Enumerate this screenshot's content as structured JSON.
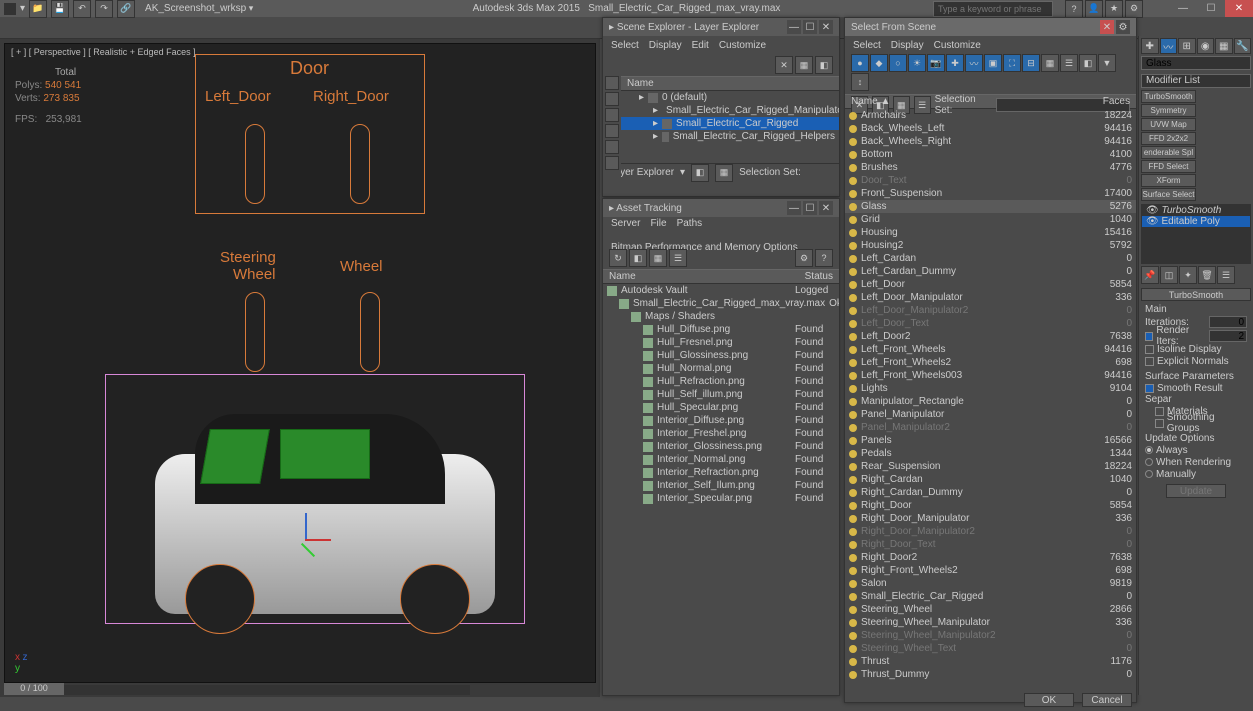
{
  "title": {
    "app": "Autodesk 3ds Max  2015",
    "file": "Small_Electric_Car_Rigged_max_vray.max"
  },
  "workspace": {
    "label": "AK_Screenshot_wrksp"
  },
  "search": {
    "placeholder": "Type a keyword or phrase"
  },
  "viewport": {
    "label": "[ + ] [ Perspective ] [ Realistic + Edged Faces ]",
    "stats_hdr": "Total",
    "polys_lbl": "Polys:",
    "polys": "540 541",
    "verts_lbl": "Verts:",
    "verts": "273 835",
    "fps_lbl": "FPS:",
    "fps": "253,981",
    "helpers": {
      "door": "Door",
      "left_door": "Left_Door",
      "right_door": "Right_Door",
      "steering": "Steering",
      "wheel1": "Wheel",
      "wheel2": "Wheel"
    },
    "timeline": "0 / 100"
  },
  "scene_explorer": {
    "title": "Scene Explorer - Layer Explorer",
    "menus": [
      "Select",
      "Display",
      "Edit",
      "Customize"
    ],
    "cols": {
      "name": "Name"
    },
    "tree": [
      {
        "label": "0 (default)",
        "indent": 1
      },
      {
        "label": "Small_Electric_Car_Rigged_Manipulator",
        "indent": 2
      },
      {
        "label": "Small_Electric_Car_Rigged",
        "indent": 2,
        "sel": true
      },
      {
        "label": "Small_Electric_Car_Rigged_Helpers",
        "indent": 2
      }
    ],
    "footer_mode": "Layer Explorer",
    "footer_sel": "Selection Set:"
  },
  "asset_tracking": {
    "title": "Asset Tracking",
    "menus": [
      "Server",
      "File",
      "Paths",
      "Bitmap Performance and Memory Options"
    ],
    "cols": {
      "name": "Name",
      "status": "Status"
    },
    "rows": [
      {
        "name": "Autodesk Vault",
        "status": "Logged",
        "indent": 0
      },
      {
        "name": "Small_Electric_Car_Rigged_max_vray.max",
        "status": "Ok",
        "indent": 1
      },
      {
        "name": "Maps / Shaders",
        "status": "",
        "indent": 2
      },
      {
        "name": "Hull_Diffuse.png",
        "status": "Found",
        "indent": 3
      },
      {
        "name": "Hull_Fresnel.png",
        "status": "Found",
        "indent": 3
      },
      {
        "name": "Hull_Glossiness.png",
        "status": "Found",
        "indent": 3
      },
      {
        "name": "Hull_Normal.png",
        "status": "Found",
        "indent": 3
      },
      {
        "name": "Hull_Refraction.png",
        "status": "Found",
        "indent": 3
      },
      {
        "name": "Hull_Self_illum.png",
        "status": "Found",
        "indent": 3
      },
      {
        "name": "Hull_Specular.png",
        "status": "Found",
        "indent": 3
      },
      {
        "name": "Interior_Diffuse.png",
        "status": "Found",
        "indent": 3
      },
      {
        "name": "Interior_Freshel.png",
        "status": "Found",
        "indent": 3
      },
      {
        "name": "Interior_Glossiness.png",
        "status": "Found",
        "indent": 3
      },
      {
        "name": "Interior_Normal.png",
        "status": "Found",
        "indent": 3
      },
      {
        "name": "Interior_Refraction.png",
        "status": "Found",
        "indent": 3
      },
      {
        "name": "Interior_Self_Ilum.png",
        "status": "Found",
        "indent": 3
      },
      {
        "name": "Interior_Specular.png",
        "status": "Found",
        "indent": 3
      }
    ]
  },
  "select_from_scene": {
    "title": "Select From Scene",
    "menus": [
      "Select",
      "Display",
      "Customize"
    ],
    "selset": "Selection Set:",
    "cols": {
      "name": "Name",
      "faces": "Faces"
    },
    "rows": [
      {
        "name": "Armchairs",
        "faces": "18224"
      },
      {
        "name": "Back_Wheels_Left",
        "faces": "94416"
      },
      {
        "name": "Back_Wheels_Right",
        "faces": "94416"
      },
      {
        "name": "Bottom",
        "faces": "4100"
      },
      {
        "name": "Brushes",
        "faces": "4776"
      },
      {
        "name": "Door_Text",
        "faces": "0",
        "frozen": true
      },
      {
        "name": "Front_Suspension",
        "faces": "17400"
      },
      {
        "name": "Glass",
        "faces": "5276",
        "sel": true
      },
      {
        "name": "Grid",
        "faces": "1040"
      },
      {
        "name": "Housing",
        "faces": "15416"
      },
      {
        "name": "Housing2",
        "faces": "5792"
      },
      {
        "name": "Left_Cardan",
        "faces": "0"
      },
      {
        "name": "Left_Cardan_Dummy",
        "faces": "0"
      },
      {
        "name": "Left_Door",
        "faces": "5854"
      },
      {
        "name": "Left_Door_Manipulator",
        "faces": "336"
      },
      {
        "name": "Left_Door_Manipulator2",
        "faces": "0",
        "frozen": true
      },
      {
        "name": "Left_Door_Text",
        "faces": "0",
        "frozen": true
      },
      {
        "name": "Left_Door2",
        "faces": "7638"
      },
      {
        "name": "Left_Front_Wheels",
        "faces": "94416"
      },
      {
        "name": "Left_Front_Wheels2",
        "faces": "698"
      },
      {
        "name": "Left_Front_Wheels003",
        "faces": "94416"
      },
      {
        "name": "Lights",
        "faces": "9104"
      },
      {
        "name": "Manipulator_Rectangle",
        "faces": "0"
      },
      {
        "name": "Panel_Manipulator",
        "faces": "0"
      },
      {
        "name": "Panel_Manipulator2",
        "faces": "0",
        "frozen": true
      },
      {
        "name": "Panels",
        "faces": "16566"
      },
      {
        "name": "Pedals",
        "faces": "1344"
      },
      {
        "name": "Rear_Suspension",
        "faces": "18224"
      },
      {
        "name": "Right_Cardan",
        "faces": "1040"
      },
      {
        "name": "Right_Cardan_Dummy",
        "faces": "0"
      },
      {
        "name": "Right_Door",
        "faces": "5854"
      },
      {
        "name": "Right_Door_Manipulator",
        "faces": "336"
      },
      {
        "name": "Right_Door_Manipulator2",
        "faces": "0",
        "frozen": true
      },
      {
        "name": "Right_Door_Text",
        "faces": "0",
        "frozen": true
      },
      {
        "name": "Right_Door2",
        "faces": "7638"
      },
      {
        "name": "Right_Front_Wheels2",
        "faces": "698"
      },
      {
        "name": "Salon",
        "faces": "9819"
      },
      {
        "name": "Small_Electric_Car_Rigged",
        "faces": "0"
      },
      {
        "name": "Steering_Wheel",
        "faces": "2866"
      },
      {
        "name": "Steering_Wheel_Manipulator",
        "faces": "336"
      },
      {
        "name": "Steering_Wheel_Manipulator2",
        "faces": "0",
        "frozen": true
      },
      {
        "name": "Steering_Wheel_Text",
        "faces": "0",
        "frozen": true
      },
      {
        "name": "Thrust",
        "faces": "1176"
      },
      {
        "name": "Thrust_Dummy",
        "faces": "0"
      }
    ],
    "ok": "OK",
    "cancel": "Cancel"
  },
  "cmd": {
    "obj_name": "Glass",
    "mod_list": "Modifier List",
    "mods": [
      "TurboSmooth",
      "Symmetry",
      "UVW Map",
      "FFD 2x2x2",
      "enderable Spl",
      "FFD Select",
      "XForm",
      "Surface Select"
    ],
    "stack": [
      {
        "label": "TurboSmooth",
        "italic": true
      },
      {
        "label": "Editable Poly",
        "sel": true
      }
    ],
    "ts": {
      "title": "TurboSmooth",
      "main": "Main",
      "iter_lbl": "Iterations:",
      "iter": "0",
      "rend_lbl": "Render Iters:",
      "rend": "2",
      "rend_on": true,
      "iso": "Isoline Display",
      "exp": "Explicit Normals",
      "surf": "Surface Parameters",
      "smooth": "Smooth Result",
      "sep": "Separ",
      "mat": "Materials",
      "grp": "Smoothing Groups",
      "upd": "Update Options",
      "always": "Always",
      "when": "When Rendering",
      "man": "Manually",
      "btn": "Update"
    }
  }
}
